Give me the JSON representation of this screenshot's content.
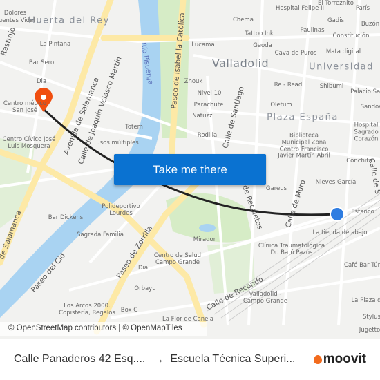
{
  "map": {
    "areas": [
      "Huerta del Rey",
      "Valladolid",
      "Universidad",
      "Plaza España"
    ],
    "river": "Río Pisuerga",
    "streets": [
      "Avenida de Salamanca",
      "Calle de Joaquín Velasco Martín",
      "Paseo de Isabel la Católica",
      "Calle de Santiago",
      "Paseo de Zorrilla",
      "Paseo del Cid",
      "Calle de Recondo",
      "Calle de Muro",
      "de Recoletos",
      "Rastrojo",
      "de Salamanca",
      "Calle de S"
    ],
    "pois": [
      "Dolores",
      "Hospital Felipe II",
      "El Torreznito",
      "París",
      "Chema",
      "Gadis",
      "Buzón d",
      "Tattoo Ink",
      "Paulinas",
      "Constitución",
      "La Pintana",
      "Lucama",
      "Geoda",
      "Cava de Puros",
      "Mata digital",
      "Bar Sero",
      "Dia",
      "Zhouk",
      "Re - Read",
      "Shibumi",
      "Palacio Santa C",
      "Nivel 10",
      "Parachute",
      "Oletum",
      "Sandova",
      "Natuzzi",
      "Centro médico San José",
      "Totem",
      "Rodilla",
      "Biblioteca Municipal Zona Centro Francisco Javier Martín Abril",
      "Hospital Sagrado Corazón",
      "Centro Cívico José Luis Mosquera",
      "usos múltiples",
      "Conchita",
      "Nieves García",
      "Gareus",
      "Estanco",
      "Polideportivo Lourdes",
      "Bar Dickens",
      "Sagrada Familia",
      "La tienda de abajo",
      "Clínica Traumatológica Dr. Baró Pazos",
      "Mirador",
      "Centro de Salud Campo Grande",
      "Dia",
      "Café Bar Tún",
      "Orbayu",
      "Valladolid - Campo Grande",
      "La Plaza d",
      "Los Arcos 2000. Copistería, Regalos",
      "Box C",
      "La Flor de Canela",
      "Stylus",
      "Jugetto",
      "Fuentes Vidal"
    ],
    "colors": {
      "route": "#222222",
      "origin": "#f04e0f",
      "destination": "#2f7de1",
      "road": "#fde9a6",
      "water": "#a9d3f2",
      "park": "#d6ecc6"
    }
  },
  "cta": "Take me there",
  "attribution": "© OpenStreetMap contributors | © OpenMapTiles",
  "footer": {
    "origin": "Calle Panaderos 42 Esq....",
    "arrow_icon": "arrow-right-icon",
    "destination": "Escuela Técnica Superi...",
    "brand": "moovit"
  }
}
